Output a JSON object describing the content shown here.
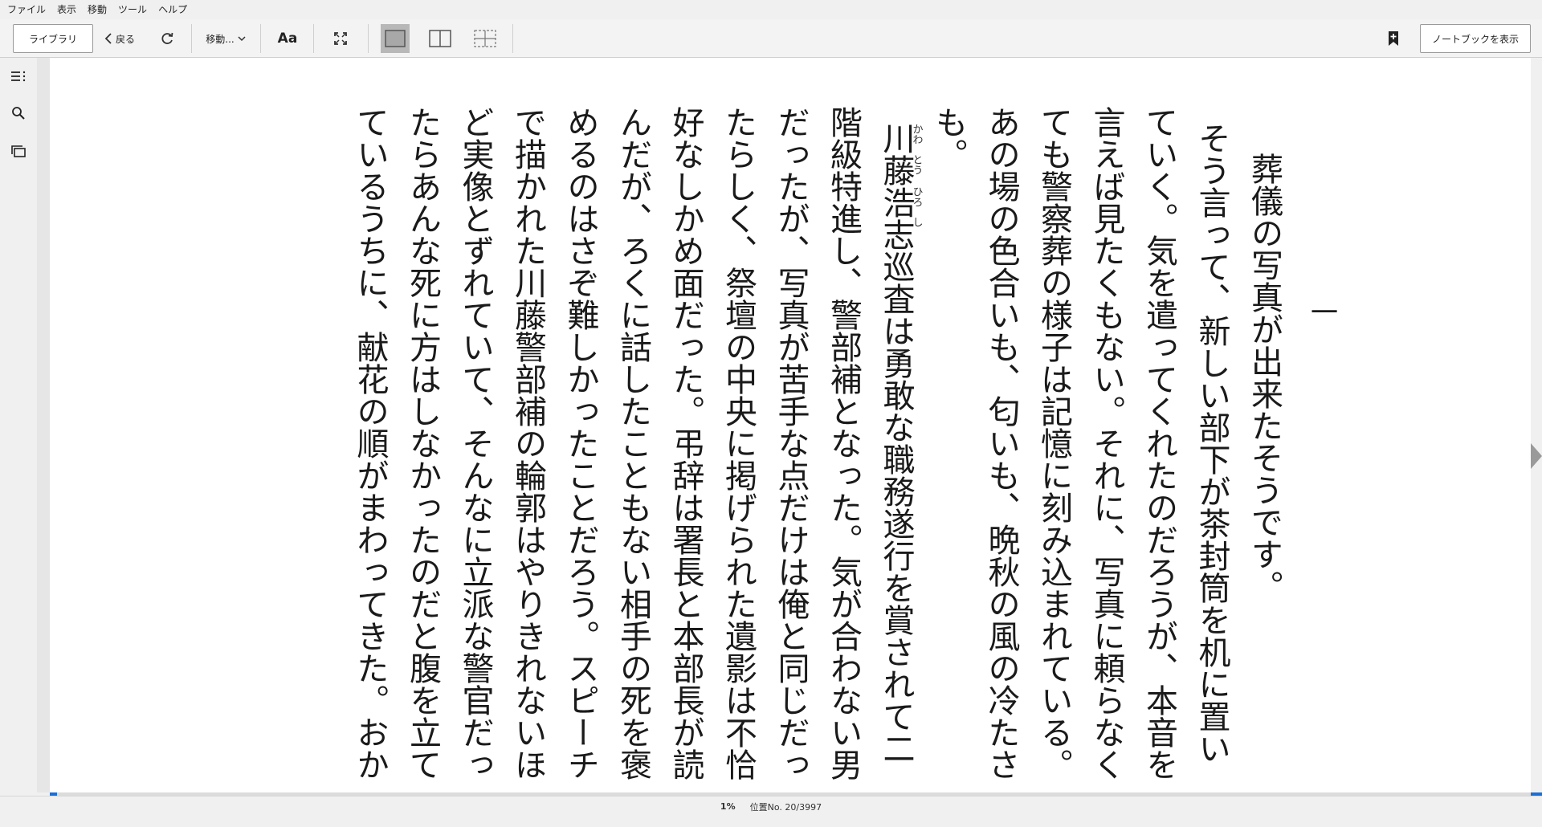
{
  "menu": [
    "ファイル",
    "表示",
    "移動",
    "ツール",
    "ヘルプ"
  ],
  "toolbar": {
    "library_label": "ライブラリ",
    "back_label": "戻る",
    "goto_label": "移動...",
    "font_label": "Aa",
    "notebook_label": "ノートブックを表示"
  },
  "icons": {
    "refresh": "refresh-icon",
    "fullscreen": "fullscreen-icon",
    "single_column": "single-column-icon",
    "two_column": "two-column-icon",
    "grid": "grid-icon",
    "bookmark": "bookmark-add-icon",
    "toc": "toc-icon",
    "search": "search-icon",
    "flashcards": "flashcards-icon"
  },
  "book": {
    "chapter": "一",
    "lines": [
      "葬儀の写真が出来たそうです。",
      "そう言って、新しい部下が茶封筒を机に置い",
      "ていく。気を遣ってくれたのだろうが、本音を",
      "言えば見たくもない。それに、写真に頼らなく",
      "ても警察葬の様子は記憶に刻み込まれている。",
      "あの場の色合いも、匂いも、晩秋の風の冷たさ",
      "も。",
      "川藤浩志巡査は勇敢な職務遂行を賞されて二",
      "階級特進し、警部補となった。気が合わない男",
      "だったが、写真が苦手な点だけは俺と同じだっ",
      "たらしく、祭壇の中央に掲げられた遺影は不恰",
      "好なしかめ面だった。弔辞は署長と本部長が読",
      "んだが、ろくに話したこともない相手の死を褒",
      "めるのはさぞ難しかったことだろう。スピーチ",
      "で描かれた川藤警部補の輪郭はやりきれないほ",
      "ど実像とずれていて、そんなに立派な警官だっ",
      "たらあんな死に方はしなかったのだと腹を立て",
      "ているうちに、献花の順がまわってきた。おか"
    ],
    "ruby": {
      "kawa": "かわ",
      "tou": "とう",
      "hiro": "ひろ",
      "shi": "し"
    }
  },
  "status": {
    "percent": "1%",
    "location": "位置No. 20/3997",
    "progress_fraction": 0.005
  },
  "colors": {
    "accent": "#1a6fd6",
    "page": "#ffffff",
    "chrome": "#f0f0f0"
  }
}
